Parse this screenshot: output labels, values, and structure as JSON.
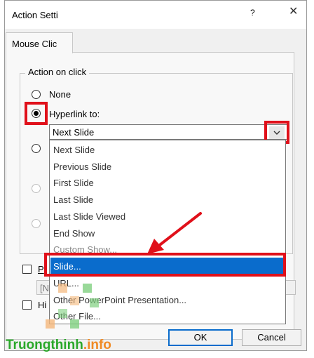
{
  "dialog": {
    "title": "Action Setti",
    "help_glyph": "?",
    "close_glyph": "✕"
  },
  "tabs": [
    {
      "label": "Mouse Clic"
    }
  ],
  "action_group": {
    "label": "Action on click",
    "option_none_label": "None",
    "option_hyperlink_label": "Hyperlink to:"
  },
  "hyperlink_combo": {
    "value": "Next Slide",
    "dropdown_glyph": "⌄"
  },
  "dropdown_list": {
    "items": [
      "Next Slide",
      "Previous Slide",
      "First Slide",
      "Last Slide",
      "Last Slide Viewed",
      "End Show",
      "Custom Show...",
      "Slide...",
      "URL...",
      "Other PowerPoint Presentation...",
      "Other File..."
    ],
    "selected": "Slide..."
  },
  "partial_labels": {
    "play_sound_fragment": "P",
    "sound_field_fragment": "[N",
    "highlight_fragment": "Hi"
  },
  "buttons": {
    "ok_label": "OK",
    "cancel_label": "Cancel"
  },
  "watermark": {
    "part1": "Truongthinh",
    "part2": ".info"
  },
  "colors": {
    "selection": "#0a6ccc",
    "highlight_box": "#e0101a",
    "watermark_green": "#2aa82a",
    "watermark_orange": "#f08a24"
  }
}
